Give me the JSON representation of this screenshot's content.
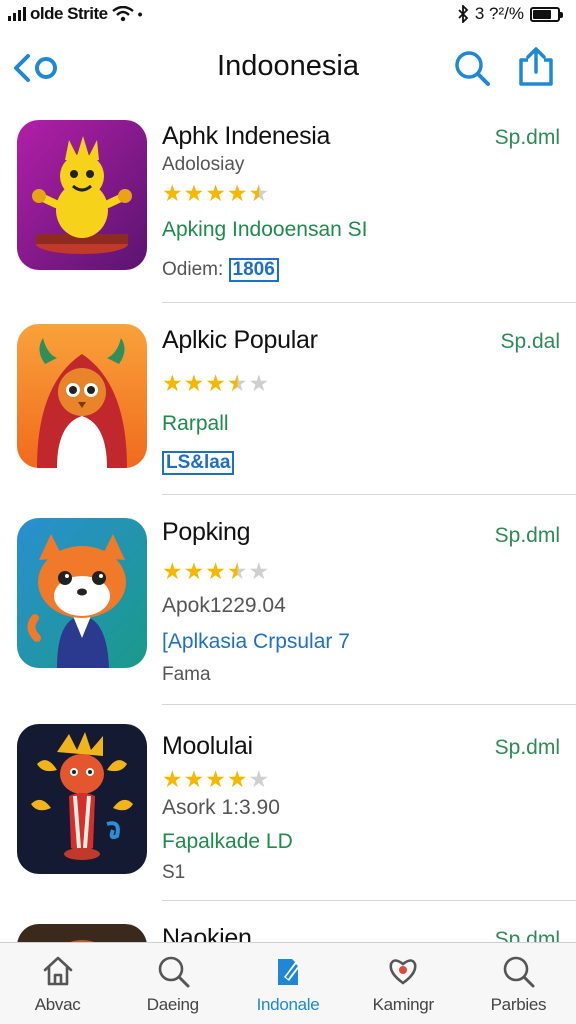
{
  "status_bar": {
    "carrier": "olde Strite",
    "right_text": "3 ?²/%",
    "battery_level": 0.75
  },
  "nav": {
    "title": "Indoonesia",
    "accent_color": "#1e88d6"
  },
  "apps": [
    {
      "name": "Aphk Indenesia",
      "price": "Sp.dml",
      "rating": 4.5,
      "lines": [
        {
          "text": "Adolosiay",
          "style": "gray"
        },
        {
          "text": "Apking  Indooensan SI",
          "style": "green"
        }
      ],
      "meta_label": "Odiem: ",
      "meta_badge": "1806"
    },
    {
      "name": "Aplkic Popular",
      "price": "Sp.dal",
      "rating": 3.5,
      "lines": [
        {
          "text": "Rarpall",
          "style": "green"
        }
      ],
      "meta_badge": "LS&laa"
    },
    {
      "name": "Popking",
      "price": "Sp.dml",
      "rating": 3.5,
      "lines": [
        {
          "text": "Apok1229.04",
          "style": "gray"
        },
        {
          "text": "[Aplkasia  Crpsular  7",
          "style": "blue"
        },
        {
          "text": "Fama",
          "style": "gray"
        }
      ]
    },
    {
      "name": "Moolulai",
      "price": "Sp.dml",
      "rating": 4,
      "lines": [
        {
          "text": "Asork 1:3.90",
          "style": "gray"
        },
        {
          "text": "Fapalkade LD",
          "style": "green"
        },
        {
          "text": "S1",
          "style": "gray"
        }
      ]
    },
    {
      "name": "Naokien",
      "price": "Sp.dml",
      "rating": 0,
      "lines": []
    }
  ],
  "tabs": [
    {
      "label": "Abvac",
      "icon": "home-icon",
      "active": false
    },
    {
      "label": "Daeing",
      "icon": "search-icon",
      "active": false
    },
    {
      "label": "Indonale",
      "icon": "edit-icon",
      "active": true
    },
    {
      "label": "Kamingr",
      "icon": "heart-icon",
      "active": false
    },
    {
      "label": "Parbies",
      "icon": "search-icon",
      "active": false
    }
  ]
}
